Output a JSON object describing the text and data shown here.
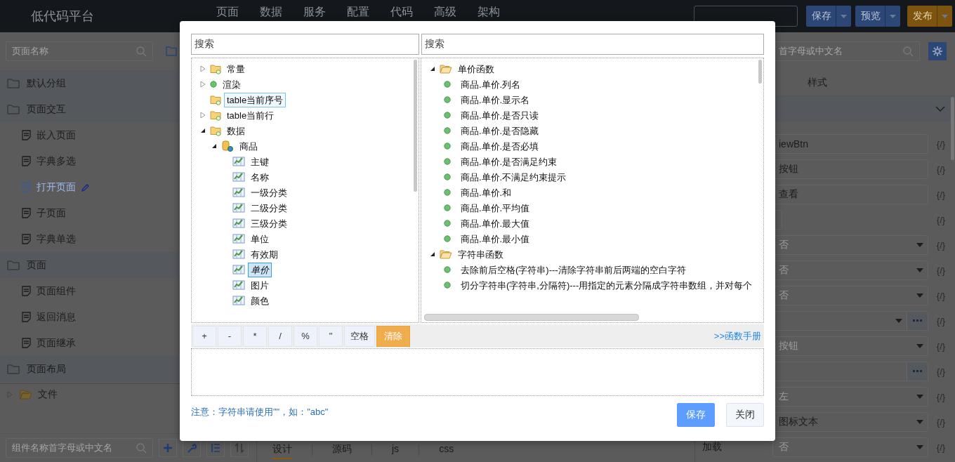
{
  "header": {
    "logo": "低代码平台",
    "nav": [
      {
        "label": "页面"
      },
      {
        "label": "数据"
      },
      {
        "label": "服务"
      },
      {
        "label": "配置"
      },
      {
        "label": "代码"
      },
      {
        "label": "高级"
      },
      {
        "label": "架构"
      }
    ],
    "buttons": [
      {
        "label": "保存",
        "kind": "primary"
      },
      {
        "label": "预览",
        "kind": "primary"
      },
      {
        "label": "发布",
        "kind": "warning"
      }
    ]
  },
  "left_panel": {
    "search": {
      "placeholder": "页面名称"
    },
    "items": [
      {
        "label": "默认分组",
        "kind": "group",
        "selected": false
      },
      {
        "label": "页面交互",
        "kind": "group",
        "selected": false
      },
      {
        "label": "嵌入页面",
        "kind": "page",
        "selected": false
      },
      {
        "label": "字典多选",
        "kind": "page",
        "selected": false
      },
      {
        "label": "打开页面",
        "kind": "page",
        "selected": true
      },
      {
        "label": "子页面",
        "kind": "page",
        "selected": false
      },
      {
        "label": "字典单选",
        "kind": "page",
        "selected": false
      },
      {
        "label": "页面",
        "kind": "group",
        "selected": false
      },
      {
        "label": "页面组件",
        "kind": "page",
        "selected": false
      },
      {
        "label": "返回消息",
        "kind": "page",
        "selected": false
      },
      {
        "label": "页面继承",
        "kind": "page",
        "selected": false
      },
      {
        "label": "页面布局",
        "kind": "group",
        "selected": false
      }
    ],
    "file_tree": {
      "label": "文件",
      "expanded": false
    },
    "bottom_search": {
      "placeholder": "组件名称首字母或中文名"
    }
  },
  "editor_tabs": [
    {
      "label": "设计",
      "selected": true
    },
    {
      "label": "源码",
      "selected": false
    },
    {
      "label": "js",
      "selected": false
    },
    {
      "label": "css",
      "selected": false
    }
  ],
  "right_panel": {
    "search": {
      "placeholder": "首字母或中文名"
    },
    "tabs": [
      {
        "label": "样式"
      }
    ],
    "properties": [
      {
        "kind": "input",
        "value": "iewBtn",
        "binding": "{/}"
      },
      {
        "kind": "input",
        "value": "按钮",
        "binding": "{/}"
      },
      {
        "kind": "input",
        "value": "查看",
        "binding": "{/}"
      },
      {
        "kind": "small",
        "binding": "{/}"
      },
      {
        "kind": "select",
        "placeholder": "否",
        "binding": "{/}"
      },
      {
        "kind": "select",
        "placeholder": "否",
        "binding": "{/}"
      },
      {
        "kind": "select",
        "placeholder": "否",
        "binding": "{/}"
      },
      {
        "kind": "select-more",
        "binding": "{/}"
      },
      {
        "kind": "select",
        "placeholder": "按钮",
        "binding": "{/}"
      },
      {
        "kind": "input-more",
        "binding": "{/}"
      },
      {
        "kind": "select",
        "placeholder": "左",
        "binding": "{/}"
      },
      {
        "kind": "select",
        "value": "图标文本",
        "binding": "{/}"
      },
      {
        "kind": "select",
        "label": "加载",
        "placeholder": "否",
        "binding": "{/}"
      }
    ]
  },
  "dialog": {
    "left_search": {
      "placeholder": "搜索"
    },
    "right_search": {
      "placeholder": "搜索"
    },
    "variable_tree": [
      {
        "label": "常量",
        "kind": "folder",
        "expanded": false,
        "selected": false,
        "focused": false
      },
      {
        "label": "渲染",
        "kind": "dot",
        "expanded": false,
        "selected": false,
        "focused": false
      },
      {
        "label": "table当前序号",
        "kind": "folder",
        "selected": false,
        "focused": true
      },
      {
        "label": "table当前行",
        "kind": "folder",
        "expanded": false,
        "selected": false,
        "focused": false
      },
      {
        "label": "数据",
        "kind": "folder",
        "expanded": true,
        "selected": false,
        "focused": false,
        "children": [
          {
            "label": "商品",
            "kind": "database",
            "expanded": true,
            "selected": false,
            "focused": false,
            "children": [
              {
                "label": "主键",
                "kind": "column",
                "selected": false,
                "focused": false
              },
              {
                "label": "名称",
                "kind": "column",
                "selected": false,
                "focused": false
              },
              {
                "label": "一级分类",
                "kind": "column",
                "selected": false,
                "focused": false
              },
              {
                "label": "二级分类",
                "kind": "column",
                "selected": false,
                "focused": false
              },
              {
                "label": "三级分类",
                "kind": "column",
                "selected": false,
                "focused": false
              },
              {
                "label": "单位",
                "kind": "column",
                "selected": false,
                "focused": false
              },
              {
                "label": "有效期",
                "kind": "column",
                "selected": false,
                "focused": false
              },
              {
                "label": "单价",
                "kind": "column",
                "selected": true,
                "focused": false
              },
              {
                "label": "图片",
                "kind": "column",
                "selected": false,
                "focused": false
              },
              {
                "label": "颜色",
                "kind": "column",
                "selected": false,
                "focused": false
              }
            ]
          }
        ]
      }
    ],
    "function_tree": [
      {
        "label": "单价函数",
        "kind": "folder-open",
        "expanded": true,
        "children": [
          {
            "label": "商品.单价.列名",
            "kind": "dot"
          },
          {
            "label": "商品.单价.显示名",
            "kind": "dot"
          },
          {
            "label": "商品.单价.是否只读",
            "kind": "dot"
          },
          {
            "label": "商品.单价.是否隐藏",
            "kind": "dot"
          },
          {
            "label": "商品.单价.是否必填",
            "kind": "dot"
          },
          {
            "label": "商品.单价.是否满足约束",
            "kind": "dot"
          },
          {
            "label": "商品.单价.不满足约束提示",
            "kind": "dot"
          },
          {
            "label": "商品.单价.和",
            "kind": "dot"
          },
          {
            "label": "商品.单价.平均值",
            "kind": "dot"
          },
          {
            "label": "商品.单价.最大值",
            "kind": "dot"
          },
          {
            "label": "商品.单价.最小值",
            "kind": "dot"
          }
        ]
      },
      {
        "label": "字符串函数",
        "kind": "folder-open",
        "expanded": true,
        "children": [
          {
            "label": "去除前后空格(字符串)---清除字符串前后两端的空白字符",
            "kind": "dot"
          },
          {
            "label": "切分字符串(字符串,分隔符)---用指定的元素分隔成字符串数组，并对每个",
            "kind": "dot"
          }
        ]
      }
    ],
    "operators": [
      {
        "label": "+",
        "kind": "operator"
      },
      {
        "label": "-",
        "kind": "operator"
      },
      {
        "label": "*",
        "kind": "operator"
      },
      {
        "label": "/",
        "kind": "operator"
      },
      {
        "label": "%",
        "kind": "operator"
      },
      {
        "label": "\"",
        "kind": "operator"
      },
      {
        "label": "空格",
        "kind": "operator"
      },
      {
        "label": "清除",
        "kind": "clear"
      }
    ],
    "manual_link": ">>函数手册",
    "note": "注意：字符串请使用\"\"，如：\"abc\"",
    "buttons": [
      {
        "label": "保存",
        "kind": "primary"
      },
      {
        "label": "关闭",
        "kind": "default"
      }
    ]
  }
}
